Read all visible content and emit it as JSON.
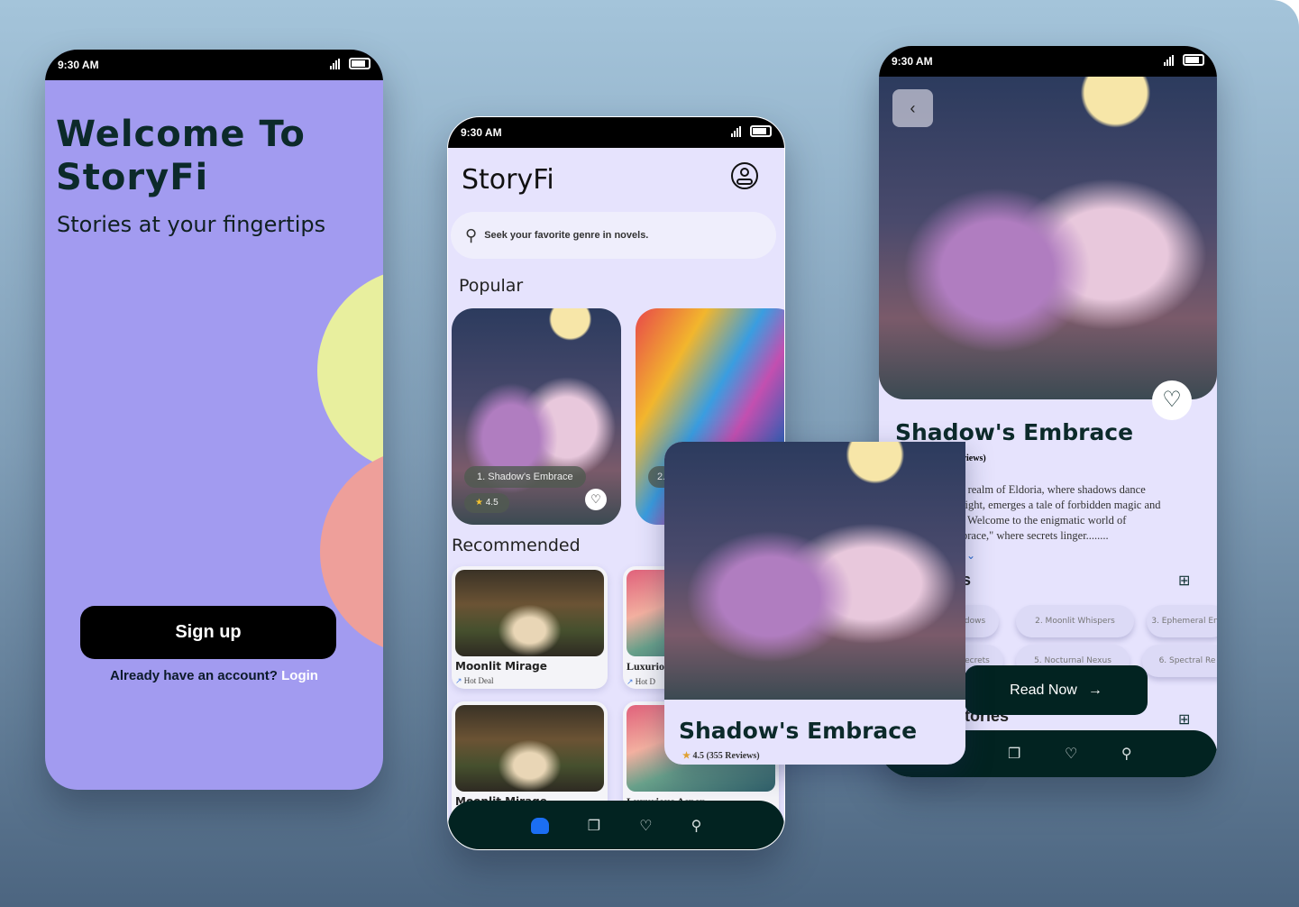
{
  "status_time": "9:30 AM",
  "welcome": {
    "title_line1": "Welcome To",
    "title_line2": "StoryFi",
    "subtitle": "Stories at your fingertips",
    "signup": "Sign up",
    "login_prompt": "Already have an account?",
    "login_link": "Login"
  },
  "home": {
    "app_title": "StoryFi",
    "search_placeholder": "Seek your favorite genre in novels.",
    "popular_label": "Popular",
    "popular": [
      {
        "rank_title": "1. Shadow's Embrace",
        "rating": "4.5"
      },
      {
        "rank_title": "2.",
        "rating": ""
      }
    ],
    "recommended_label": "Recommended",
    "recommended": [
      {
        "title": "Moonlit Mirage",
        "tag": "Hot Deal"
      },
      {
        "title": "Luxurio",
        "tag": "Hot D"
      },
      {
        "title": "Moonlit Mirage",
        "tag": ""
      },
      {
        "title": "Luxurious Aspen",
        "tag": ""
      }
    ]
  },
  "overlay": {
    "title": "Shadow's Embrace",
    "rating": "4.5 (355 Reviews)"
  },
  "detail": {
    "title": "Shadow's Embrace",
    "reviews": "views)",
    "description": [
      "l realm of Eldoria, where shadows dance",
      "light, emerges a tale of forbidden magic and",
      ". Welcome to the enigmatic world of",
      "brace,\" where secrets linger........"
    ],
    "section1": "s",
    "chapters": [
      "dows",
      "2. Moonlit Whispers",
      "3. Ephemeral Enc",
      "ecrets",
      "5. Nocturnal Nexus",
      "6. Spectral Re"
    ],
    "read_now": "Read Now",
    "section2": "tories"
  },
  "colors": {
    "welcome_bg": "#a29bf0",
    "app_bg": "#e6e3fd",
    "nav_bg": "#022321",
    "accent": "#1b6ef3"
  }
}
